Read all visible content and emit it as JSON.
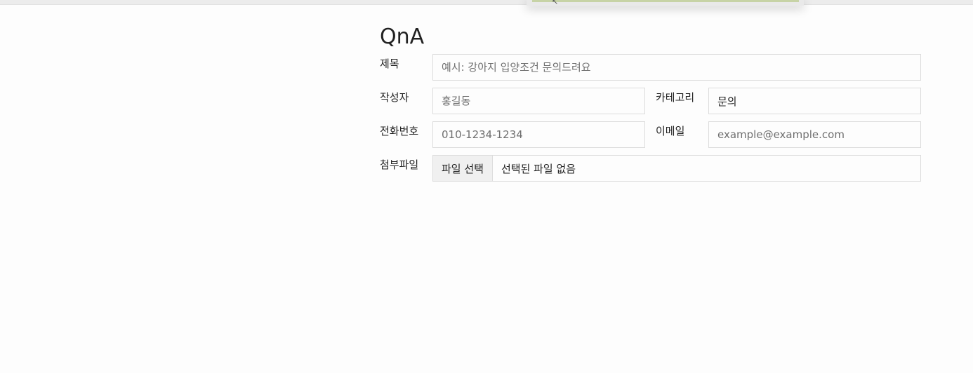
{
  "form": {
    "heading": "QnA",
    "title": {
      "label": "제목",
      "placeholder": "예시: 강아지 입양조건 문의드려요"
    },
    "author": {
      "label": "작성자",
      "placeholder": "홍길동"
    },
    "category": {
      "label": "카테고리",
      "value": "문의"
    },
    "phone": {
      "label": "전화번호",
      "placeholder": "010-1234-1234"
    },
    "email": {
      "label": "이메일",
      "placeholder": "example@example.com"
    },
    "attachment": {
      "label": "첨부파일",
      "button_label": "파일 선택",
      "status": "선택된 파일 없음"
    }
  }
}
